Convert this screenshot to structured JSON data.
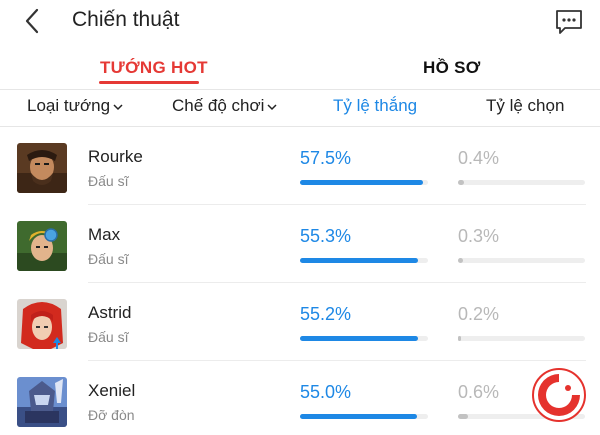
{
  "header": {
    "title": "Chiến thuật",
    "back_icon": "chevron-left-icon",
    "chat_icon": "chat-bubble-icon"
  },
  "tabs": [
    {
      "label": "TƯỚNG HOT",
      "active": true
    },
    {
      "label": "HỒ SƠ",
      "active": false
    }
  ],
  "filters": {
    "hero_type": "Loại tướng",
    "game_mode": "Chế độ chơi",
    "win_rate": "Tỷ lệ thắng",
    "pick_rate": "Tỷ lệ chọn"
  },
  "colors": {
    "accent_red": "#e53935",
    "accent_blue": "#1e88e5",
    "muted_gray": "#b8b8b8"
  },
  "heroes": [
    {
      "name": "Rourke",
      "role": "Đấu sĩ",
      "win_rate": "57.5%",
      "win_fraction": 0.575,
      "pick_rate": "0.4%",
      "pick_fraction": 0.004
    },
    {
      "name": "Max",
      "role": "Đấu sĩ",
      "win_rate": "55.3%",
      "win_fraction": 0.553,
      "pick_rate": "0.3%",
      "pick_fraction": 0.003
    },
    {
      "name": "Astrid",
      "role": "Đấu sĩ",
      "win_rate": "55.2%",
      "win_fraction": 0.552,
      "pick_rate": "0.2%",
      "pick_fraction": 0.002
    },
    {
      "name": "Xeniel",
      "role": "Đỡ đòn",
      "win_rate": "55.0%",
      "win_fraction": 0.55,
      "pick_rate": "0.6%",
      "pick_fraction": 0.006
    }
  ]
}
